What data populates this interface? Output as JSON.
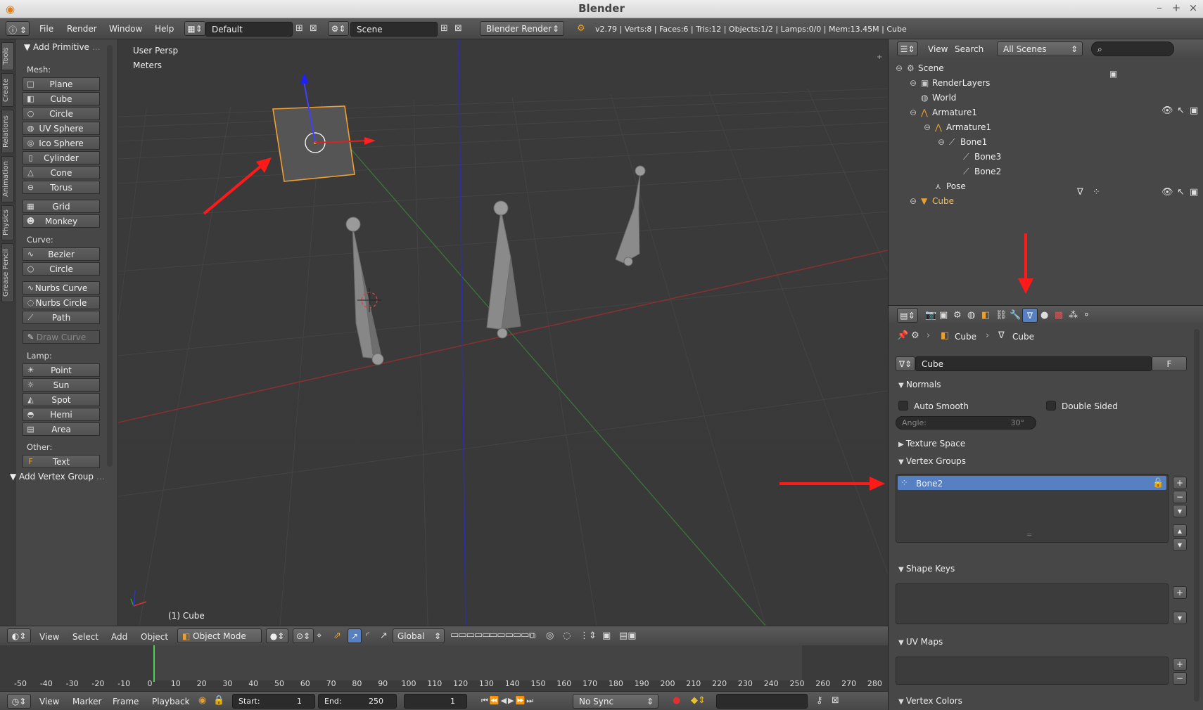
{
  "window": {
    "title": "Blender"
  },
  "info_header": {
    "menus": [
      "File",
      "Render",
      "Window",
      "Help"
    ],
    "layout": "Default",
    "scene": "Scene",
    "engine": "Blender Render",
    "stats": "v2.79 | Verts:8 | Faces:6 | Tris:12 | Objects:1/2 | Lamps:0/0 | Mem:13.45M | Cube"
  },
  "tool_tabs": [
    "Tools",
    "Create",
    "Relations",
    "Animation",
    "Physics",
    "Grease Pencil"
  ],
  "tool_shelf": {
    "header": "Add Primitive",
    "mesh_label": "Mesh:",
    "mesh": [
      "Plane",
      "Cube",
      "Circle",
      "UV Sphere",
      "Ico Sphere",
      "Cylinder",
      "Cone",
      "Torus",
      "Grid",
      "Monkey"
    ],
    "curve_label": "Curve:",
    "curve": [
      "Bezier",
      "Circle",
      "Nurbs Curve",
      "Nurbs Circle",
      "Path",
      "Draw Curve"
    ],
    "lamp_label": "Lamp:",
    "lamp": [
      "Point",
      "Sun",
      "Spot",
      "Hemi",
      "Area"
    ],
    "other_label": "Other:",
    "other": [
      "Text"
    ],
    "footer": "Add Vertex Group"
  },
  "viewport": {
    "view": "User Persp",
    "units": "Meters",
    "object_label": "(1) Cube"
  },
  "view3d_header": {
    "menus": [
      "View",
      "Select",
      "Add",
      "Object"
    ],
    "mode": "Object Mode",
    "orientation": "Global"
  },
  "timeline": {
    "ticks": [
      "-50",
      "-40",
      "-30",
      "-20",
      "-10",
      "0",
      "10",
      "20",
      "30",
      "40",
      "50",
      "60",
      "70",
      "80",
      "90",
      "100",
      "110",
      "120",
      "130",
      "140",
      "150",
      "160",
      "170",
      "180",
      "190",
      "200",
      "210",
      "220",
      "230",
      "240",
      "250",
      "260",
      "270",
      "280"
    ],
    "menus": [
      "View",
      "Marker",
      "Frame",
      "Playback"
    ],
    "start_label": "Start:",
    "start": "1",
    "end_label": "End:",
    "end": "250",
    "current": "1",
    "sync": "No Sync"
  },
  "outliner": {
    "menus": [
      "View",
      "Search"
    ],
    "filter": "All Scenes",
    "tree": [
      {
        "label": "Scene",
        "indent": 0,
        "icon": "scene-icon"
      },
      {
        "label": "RenderLayers",
        "indent": 1,
        "icon": "render-layers-icon"
      },
      {
        "label": "World",
        "indent": 1,
        "icon": "world-icon"
      },
      {
        "label": "Armature1",
        "indent": 1,
        "icon": "armature-object-icon"
      },
      {
        "label": "Armature1",
        "indent": 2,
        "icon": "armature-data-icon"
      },
      {
        "label": "Bone1",
        "indent": 3,
        "icon": "bone-icon"
      },
      {
        "label": "Bone3",
        "indent": 4,
        "icon": "bone-icon"
      },
      {
        "label": "Bone2",
        "indent": 4,
        "icon": "bone-icon"
      },
      {
        "label": "Pose",
        "indent": 2,
        "icon": "pose-icon"
      },
      {
        "label": "Cube",
        "indent": 1,
        "icon": "mesh-object-icon"
      }
    ]
  },
  "properties": {
    "breadcrumb": [
      "Cube",
      "Cube"
    ],
    "datablock": "Cube",
    "datablock_fake": "F",
    "normals": {
      "title": "Normals",
      "auto_smooth": "Auto Smooth",
      "double_sided": "Double Sided",
      "angle_label": "Angle:",
      "angle_value": "30°"
    },
    "texture_space": "Texture Space",
    "vertex_groups": {
      "title": "Vertex Groups",
      "items": [
        "Bone2"
      ]
    },
    "shape_keys": "Shape Keys",
    "uv_maps": "UV Maps",
    "vertex_colors": "Vertex Colors"
  },
  "colors": {
    "accent_selected": "#5680c2",
    "annotation_arrow": "#ff1a1a",
    "selected_object": "#f0a030"
  }
}
